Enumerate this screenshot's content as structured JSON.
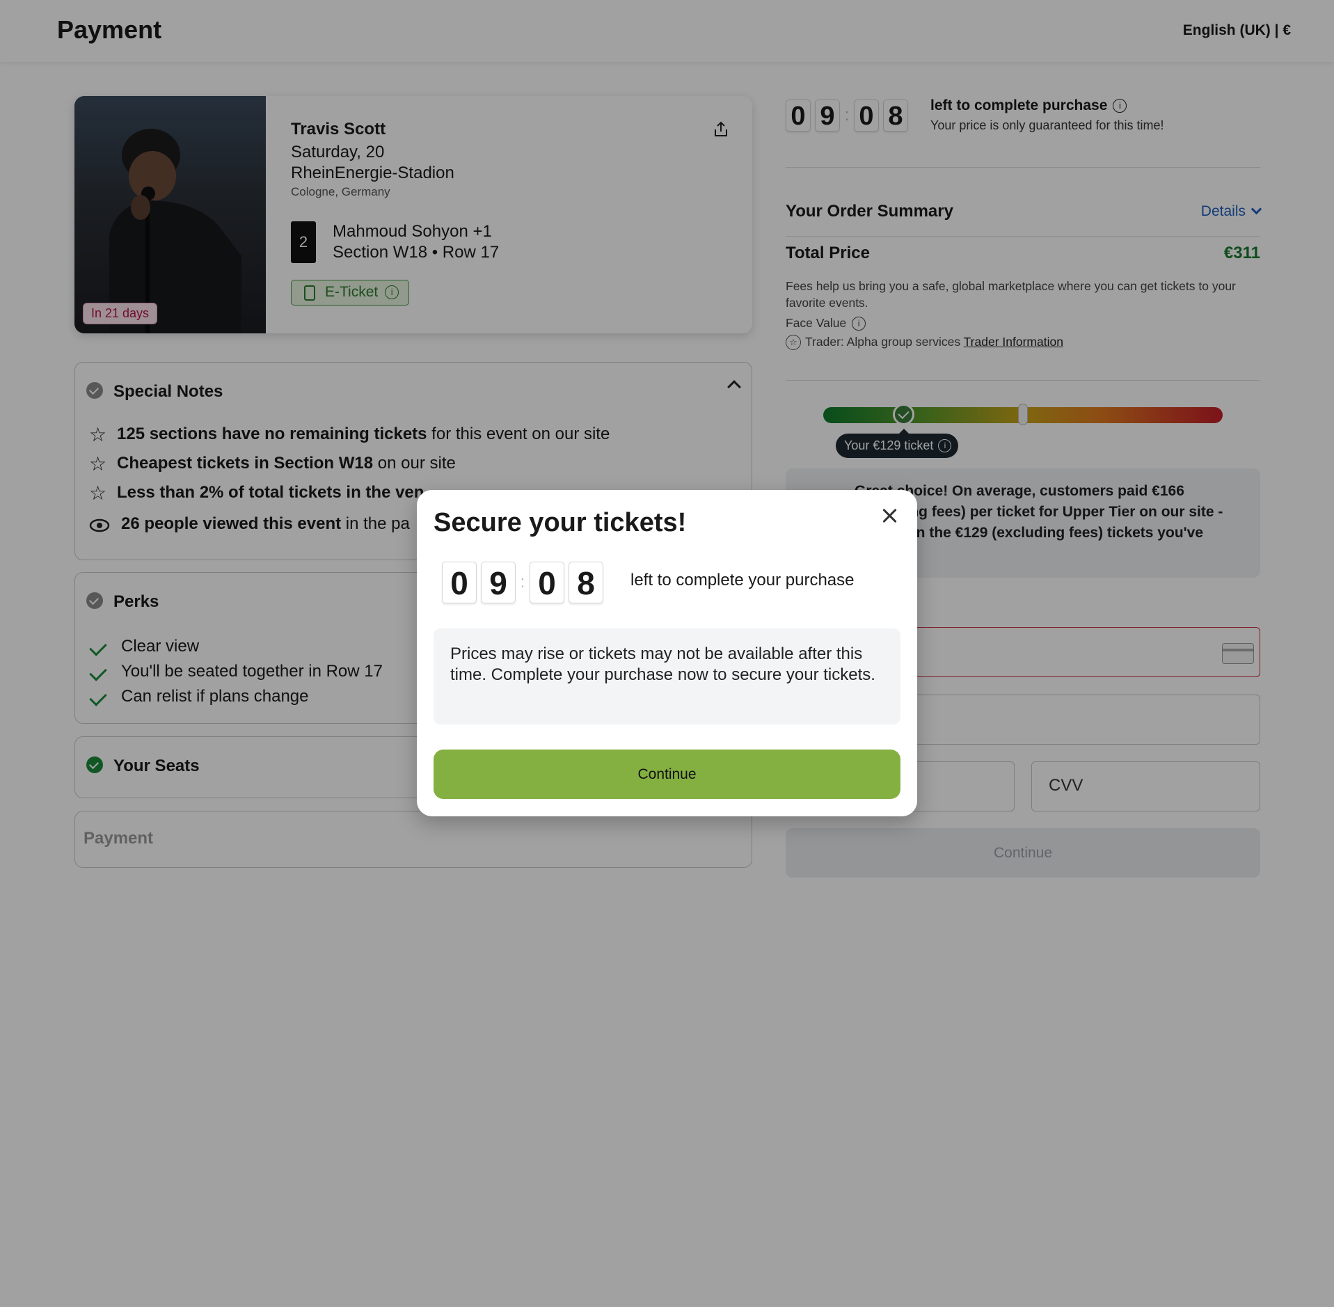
{
  "header": {
    "title": "Payment",
    "locale": "English (UK) | €"
  },
  "event": {
    "days_badge": "In 21 days",
    "artist": "Travis Scott",
    "date": "Saturday, 20",
    "venue": "RheinEnergie-Stadion",
    "city": "Cologne, Germany",
    "ticket_count": "2",
    "holder": "Mahmoud Sohyon +1",
    "seat": "Section W18 • Row 17",
    "ticket_type": "E-Ticket"
  },
  "special_notes": {
    "title": "Special Notes",
    "items": [
      {
        "bold": "125 sections have no remaining tickets",
        "rest": " for this event on our site"
      },
      {
        "bold": "Cheapest tickets in Section W18",
        "rest": " on our site"
      },
      {
        "bold": "Less than 2% of total tickets in the ven",
        "rest": ""
      },
      {
        "bold": "26 people viewed this event",
        "rest": " in the pa"
      }
    ]
  },
  "perks": {
    "title": "Perks",
    "items": [
      "Clear view",
      "You'll be seated together in Row 17",
      "Can relist if plans change"
    ]
  },
  "your_seats": {
    "title": "Your Seats"
  },
  "payment_step": {
    "title": "Payment"
  },
  "timer": {
    "digits": [
      "0",
      "9",
      "0",
      "8"
    ],
    "title": "left to complete purchase",
    "subtitle": "Your price is only guaranteed for this time!"
  },
  "summary": {
    "title": "Your Order Summary",
    "details_label": "Details",
    "total_label": "Total Price",
    "total_value": "€311",
    "fees_text": "Fees help us bring you a safe, global marketplace where you can get tickets to your favorite events.",
    "face_value_label": "Face Value",
    "trader_label": "Trader: Alpha group services",
    "trader_link": "Trader Information"
  },
  "price_bar": {
    "ticket_tip": "Your €129 ticket",
    "ticket_position": 0.2,
    "average_position": 0.5
  },
  "choice": {
    "text": "Great choice! On average, customers paid €166 (excluding fees) per ticket for Upper Tier on our site - more than the €129 (excluding fees) tickets you've chosen."
  },
  "card_form": {
    "cvv_placeholder": "CVV",
    "continue_label": "Continue"
  },
  "modal": {
    "title": "Secure your tickets!",
    "digits": [
      "0",
      "9",
      "0",
      "8"
    ],
    "left_text": "left to complete your purchase",
    "note": "Prices may rise or tickets may not be available after this time. Complete your purchase now to secure your tickets.",
    "continue_label": "Continue"
  },
  "colors": {
    "accent_green": "#84b042",
    "total_green": "#1a7a2e",
    "link_blue": "#1f5fbf"
  }
}
